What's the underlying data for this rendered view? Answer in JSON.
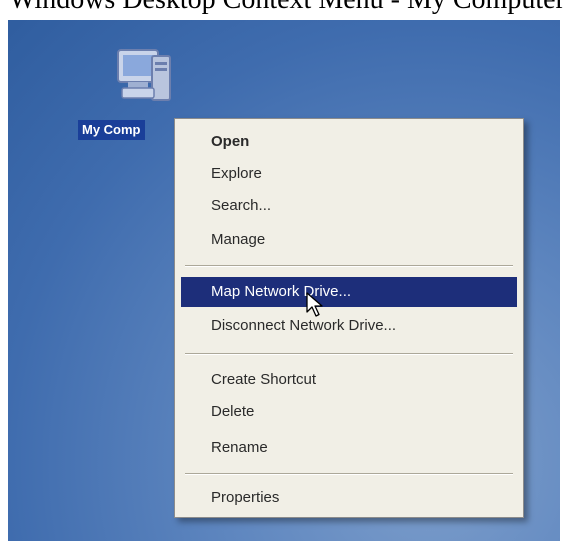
{
  "caption": {
    "text": "Windows Desktop Context Menu - My Computer"
  },
  "desktop": {
    "icon": {
      "label": "My Comp",
      "icon_name": "my-computer-icon"
    }
  },
  "context_menu": {
    "items": [
      {
        "label": "Open",
        "bold": true
      },
      {
        "label": "Explore"
      },
      {
        "label": "Search..."
      },
      {
        "label": "Manage"
      },
      {
        "label": "Map Network Drive...",
        "highlighted": true
      },
      {
        "label": "Disconnect Network Drive..."
      },
      {
        "label": "Create Shortcut"
      },
      {
        "label": "Delete"
      },
      {
        "label": "Rename"
      },
      {
        "label": "Properties"
      }
    ]
  },
  "colors": {
    "desktop_blue": "#3f6cae",
    "menu_background": "#f1efe6",
    "selection": "#1d2e7a",
    "icon_label_background": "#1a3f99"
  }
}
